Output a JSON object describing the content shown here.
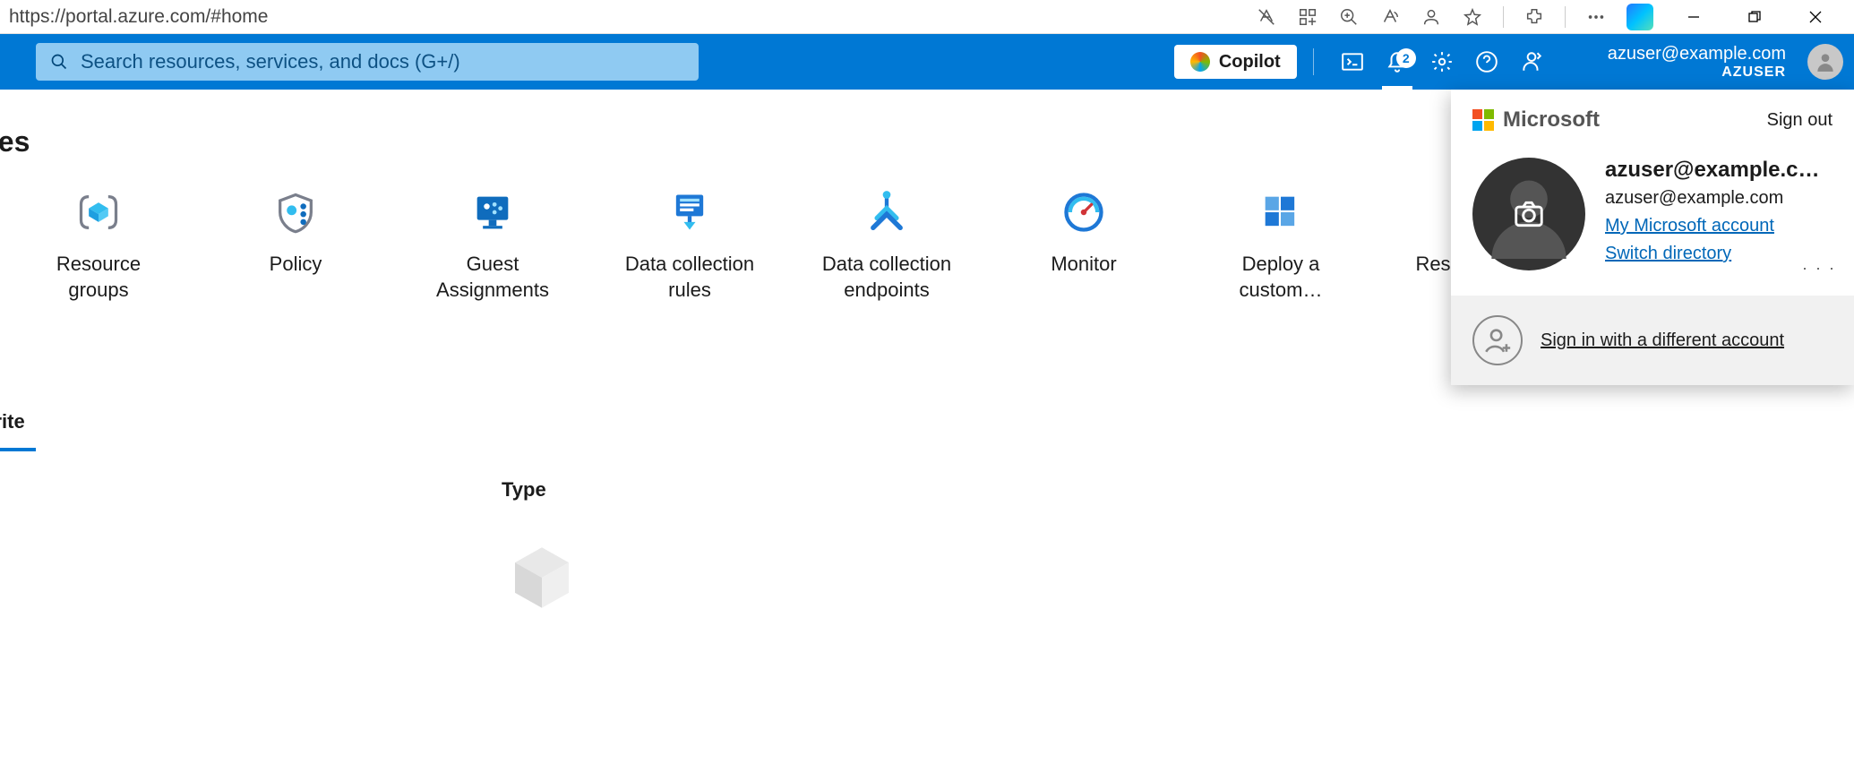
{
  "browser": {
    "url": "https://portal.azure.com/#home"
  },
  "header": {
    "search_placeholder": "Search resources, services, and docs (G+/)",
    "copilot_label": "Copilot",
    "notification_count": "2",
    "user_email": "azuser@example.com",
    "tenant": "AZUSER"
  },
  "sections": {
    "services_title": "ces",
    "tab_label": "orite",
    "column_header": "Type"
  },
  "services": [
    {
      "label": "Resource groups"
    },
    {
      "label": "Policy"
    },
    {
      "label": "Guest Assignments"
    },
    {
      "label": "Data collection rules"
    },
    {
      "label": "Data collection endpoints"
    },
    {
      "label": "Monitor"
    },
    {
      "label": "Deploy a custom…"
    },
    {
      "label": "Res"
    }
  ],
  "flyout": {
    "brand": "Microsoft",
    "signout": "Sign out",
    "display_name": "azuser@example.c…",
    "email": "azuser@example.com",
    "link_account": "My Microsoft account",
    "link_switch": "Switch directory",
    "more": "· · ·",
    "different_account": "Sign in with a different account"
  }
}
